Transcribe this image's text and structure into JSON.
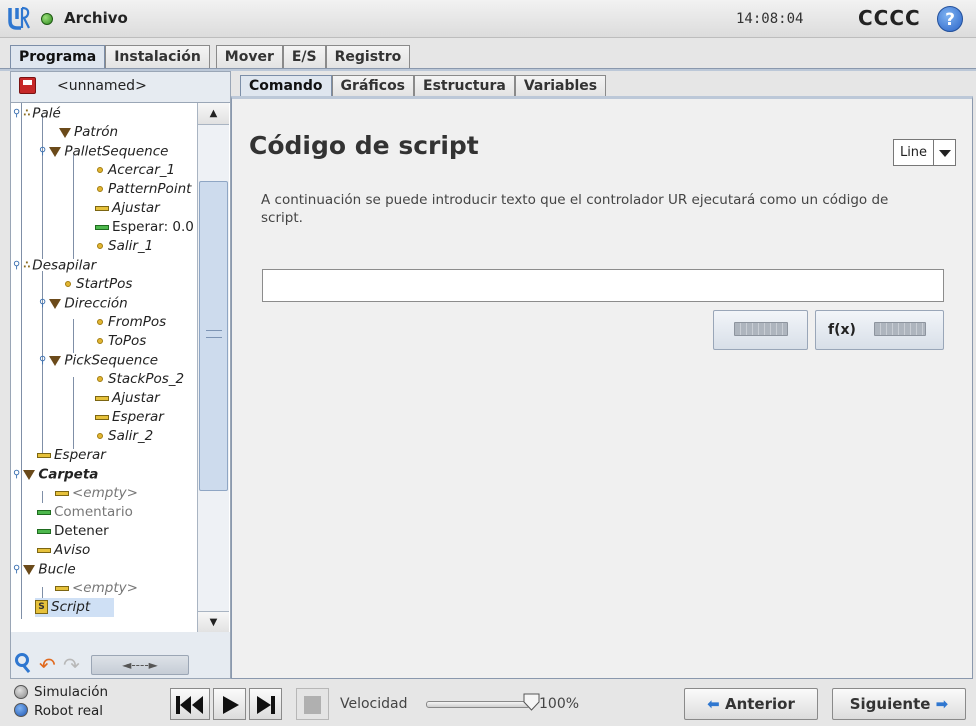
{
  "topbar": {
    "file_label": "Archivo",
    "clock": "14:08:04",
    "robot_name": "CCCC",
    "help_glyph": "?"
  },
  "main_tabs": [
    "Programa",
    "Instalación",
    "Mover",
    "E/S",
    "Registro"
  ],
  "program": {
    "name": "<unnamed>"
  },
  "tree": [
    {
      "label": "Palé"
    },
    {
      "label": "Patrón"
    },
    {
      "label": "PalletSequence"
    },
    {
      "label": "Acercar_1"
    },
    {
      "label": "PatternPoint"
    },
    {
      "label": "Ajustar"
    },
    {
      "label": "Esperar: 0.0"
    },
    {
      "label": "Salir_1"
    },
    {
      "label": "Desapilar"
    },
    {
      "label": "StartPos"
    },
    {
      "label": "Dirección"
    },
    {
      "label": "FromPos"
    },
    {
      "label": "ToPos"
    },
    {
      "label": "PickSequence"
    },
    {
      "label": "StackPos_2"
    },
    {
      "label": "Ajustar"
    },
    {
      "label": "Esperar"
    },
    {
      "label": "Salir_2"
    },
    {
      "label": "Esperar"
    },
    {
      "label": "Carpeta"
    },
    {
      "label": "<empty>"
    },
    {
      "label": "Comentario"
    },
    {
      "label": "Detener"
    },
    {
      "label": "Aviso"
    },
    {
      "label": "Bucle"
    },
    {
      "label": "<empty>"
    },
    {
      "label": "Script"
    }
  ],
  "tree_tools": {
    "move_label": "◄----►"
  },
  "sub_tabs": [
    "Comando",
    "Gráficos",
    "Estructura",
    "Variables"
  ],
  "content": {
    "title": "Código de script",
    "mode": "Line",
    "description": "A continuación se puede introducir texto que el controlador UR ejecutará como un código de script.",
    "script_value": "",
    "fx_label": "f(x)"
  },
  "footer": {
    "simulation_label": "Simulación",
    "real_robot_label": "Robot real",
    "speed_label": "Velocidad",
    "speed_value": "100%",
    "speed_fraction": 1.0,
    "prev_label": "Anterior",
    "next_label": "Siguiente"
  },
  "colors": {
    "accent_blue": "#2f77d0",
    "status_green": "#2e8a1e",
    "undo_orange": "#e16a1f"
  }
}
